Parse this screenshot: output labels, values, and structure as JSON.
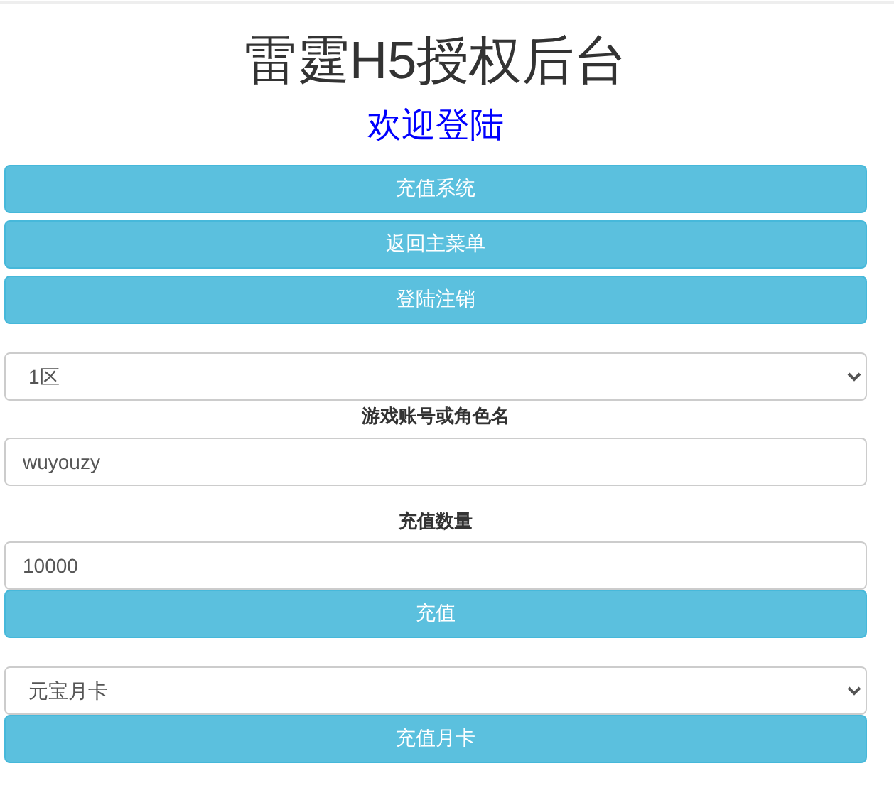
{
  "title": "雷霆H5授权后台",
  "subtitle": "欢迎登陆",
  "nav_buttons": [
    "充值系统",
    "返回主菜单",
    "登陆注销"
  ],
  "server_select": {
    "value": "1区"
  },
  "account": {
    "label": "游戏账号或角色名",
    "value": "wuyouzy"
  },
  "amount": {
    "label": "充值数量",
    "value": "10000"
  },
  "recharge_button": "充值",
  "card_select": {
    "value": "元宝月卡"
  },
  "card_button": "充值月卡"
}
